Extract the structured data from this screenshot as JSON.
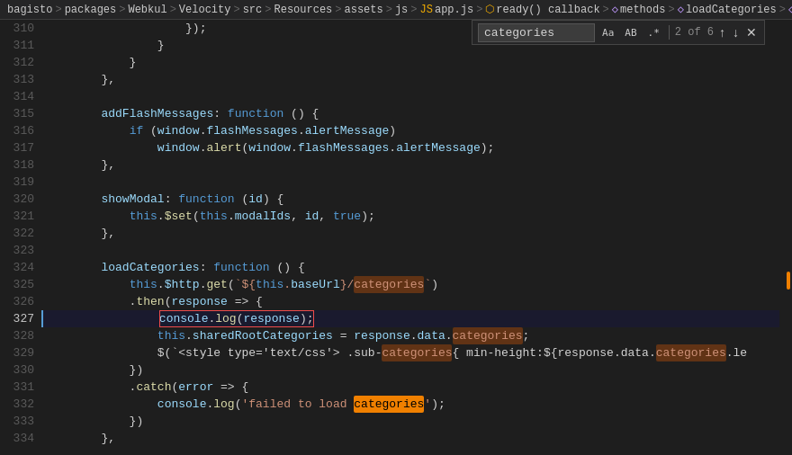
{
  "breadcrumb": {
    "items": [
      {
        "label": "bagisto",
        "icon": null
      },
      {
        "label": "packages",
        "icon": null
      },
      {
        "label": "Webkul",
        "icon": null
      },
      {
        "label": "Velocity",
        "icon": null
      },
      {
        "label": "src",
        "icon": null
      },
      {
        "label": "Resources",
        "icon": null
      },
      {
        "label": "assets",
        "icon": null
      },
      {
        "label": "js",
        "icon": null
      },
      {
        "label": "app.js",
        "icon": "js"
      },
      {
        "label": "ready() callback",
        "icon": "func"
      },
      {
        "label": "methods",
        "icon": "method"
      },
      {
        "label": "loadCategories",
        "icon": "method"
      },
      {
        "label": "",
        "icon": "method"
      }
    ]
  },
  "search": {
    "query": "categories",
    "count": "2 of 6",
    "placeholder": "categories"
  },
  "lines": [
    {
      "num": 310,
      "content": "                    });",
      "type": "plain"
    },
    {
      "num": 311,
      "content": "                }",
      "type": "plain"
    },
    {
      "num": 312,
      "content": "            }",
      "type": "plain"
    },
    {
      "num": 313,
      "content": "        },",
      "type": "plain"
    },
    {
      "num": 314,
      "content": "",
      "type": "empty"
    },
    {
      "num": 315,
      "content": "        addFlashMessages: function () {",
      "type": "code"
    },
    {
      "num": 316,
      "content": "            if (window.flashMessages.alertMessage)",
      "type": "code"
    },
    {
      "num": 317,
      "content": "                window.alert(window.flashMessages.alertMessage);",
      "type": "code"
    },
    {
      "num": 318,
      "content": "        },",
      "type": "plain"
    },
    {
      "num": 319,
      "content": "",
      "type": "empty"
    },
    {
      "num": 320,
      "content": "        showModal: function (id) {",
      "type": "code"
    },
    {
      "num": 321,
      "content": "            this.$set(this.modalIds, id, true);",
      "type": "code"
    },
    {
      "num": 322,
      "content": "        },",
      "type": "plain"
    },
    {
      "num": 323,
      "content": "",
      "type": "empty"
    },
    {
      "num": 324,
      "content": "        loadCategories: function () {",
      "type": "code"
    },
    {
      "num": 325,
      "content": "            this.$http.get(`${this.baseUrl}/categories`)",
      "type": "code"
    },
    {
      "num": 326,
      "content": "            .then(response => {",
      "type": "code"
    },
    {
      "num": 327,
      "content": "                console.log(response);",
      "type": "highlighted"
    },
    {
      "num": 328,
      "content": "                this.sharedRootCategories = response.data.categories;",
      "type": "code"
    },
    {
      "num": 329,
      "content": "                $(`<style type='text/css'> .sub-categories{ min-height:${response.data.categories.le",
      "type": "code"
    },
    {
      "num": 330,
      "content": "            })",
      "type": "plain"
    },
    {
      "num": 331,
      "content": "            .catch(error => {",
      "type": "code"
    },
    {
      "num": 332,
      "content": "                console.log('failed to load categories');",
      "type": "code"
    },
    {
      "num": 333,
      "content": "            })",
      "type": "plain"
    },
    {
      "num": 334,
      "content": "        },",
      "type": "plain"
    }
  ]
}
